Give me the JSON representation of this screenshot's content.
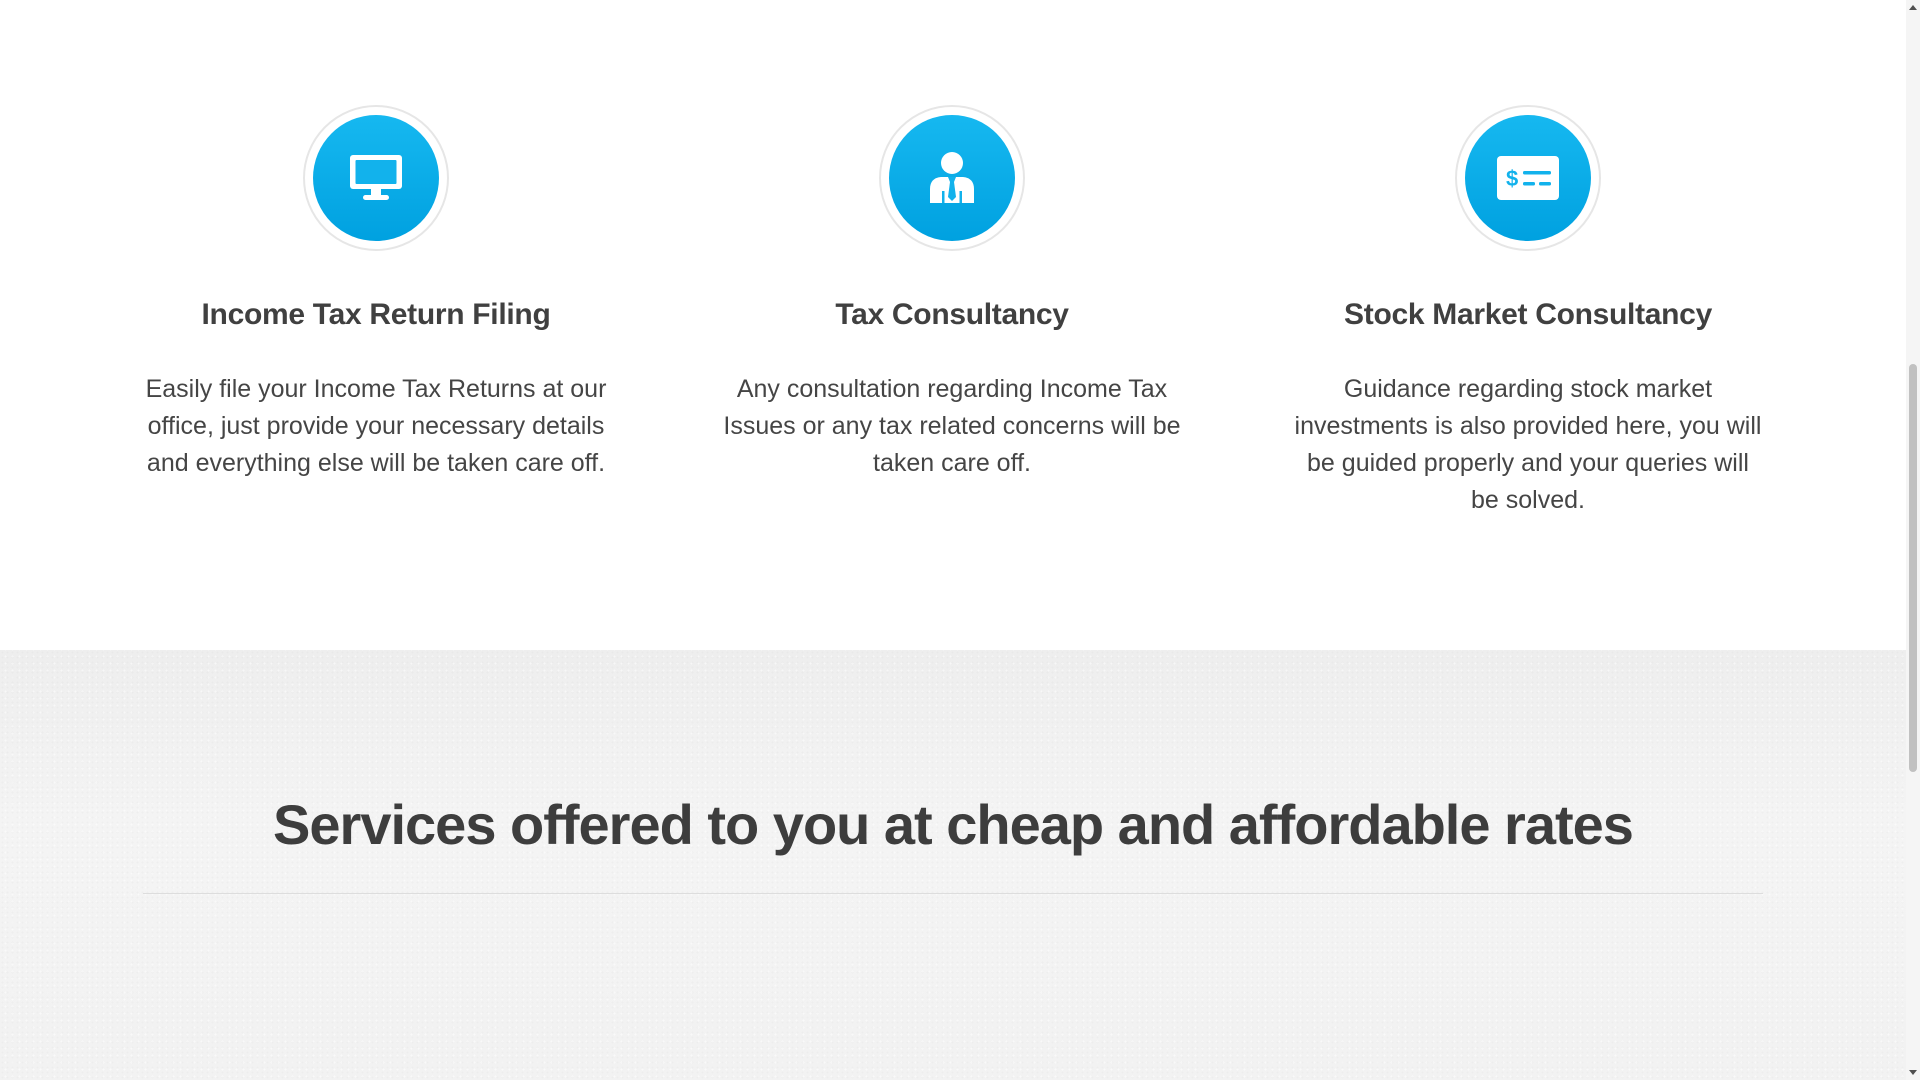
{
  "features": [
    {
      "icon": "monitor-icon",
      "title": "Income Tax Return Filing",
      "text": "Easily file your Income Tax Returns at our office, just provide your necessary details and everything else will be taken care off."
    },
    {
      "icon": "businessman-icon",
      "title": "Tax Consultancy",
      "text": "Any consultation regarding Income Tax Issues or any tax related concerns will be taken care off."
    },
    {
      "icon": "money-check-icon",
      "title": "Stock Market Consultancy",
      "text": "Guidance regarding stock market investments is also provided here, you will be guided properly and your queries will be solved."
    }
  ],
  "services": {
    "title": "Services offered to you at cheap and affordable rates"
  },
  "colors": {
    "accent": "#00a6e6",
    "heading": "#404040",
    "body_text": "#454545",
    "section_background": "#f3f3f3"
  }
}
